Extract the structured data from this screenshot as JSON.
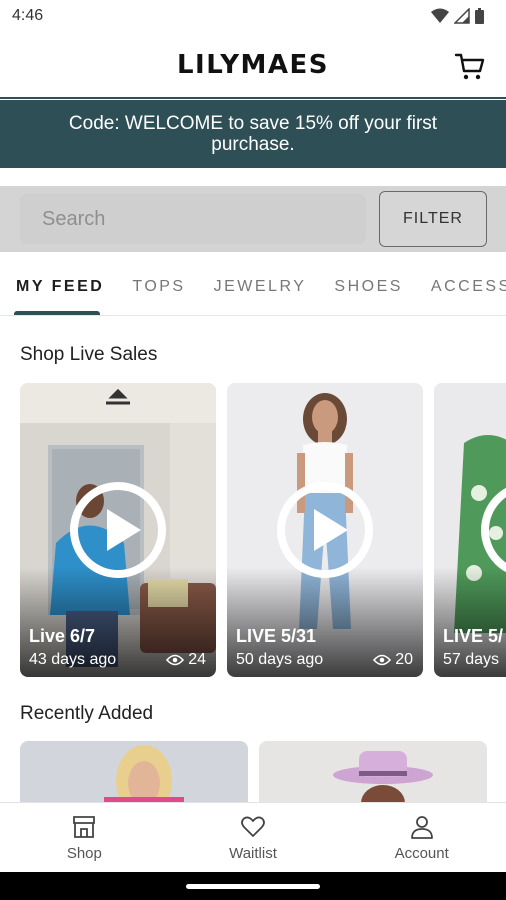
{
  "status": {
    "time": "4:46"
  },
  "header": {
    "brand": "LILYMAES"
  },
  "promo": {
    "text": "Code: WELCOME to save 15% off your first purchase."
  },
  "search": {
    "placeholder": "Search",
    "filter_label": "FILTER"
  },
  "tabs": [
    {
      "label": "MY FEED",
      "active": true
    },
    {
      "label": "TOPS"
    },
    {
      "label": "JEWELRY"
    },
    {
      "label": "SHOES"
    },
    {
      "label": "ACCESS"
    }
  ],
  "live_sales": {
    "title": "Shop Live Sales",
    "cards": [
      {
        "label": "Live 6/7",
        "ago": "43 days ago",
        "views": "24"
      },
      {
        "label": "LIVE 5/31",
        "ago": "50 days ago",
        "views": "20"
      },
      {
        "label": "LIVE 5/",
        "ago": "57 days",
        "views": ""
      }
    ]
  },
  "recently_added": {
    "title": "Recently Added"
  },
  "nav": [
    {
      "label": "Shop",
      "icon": "storefront-icon"
    },
    {
      "label": "Waitlist",
      "icon": "heart-icon"
    },
    {
      "label": "Account",
      "icon": "person-icon"
    }
  ],
  "colors": {
    "accent": "#2e4f56"
  }
}
